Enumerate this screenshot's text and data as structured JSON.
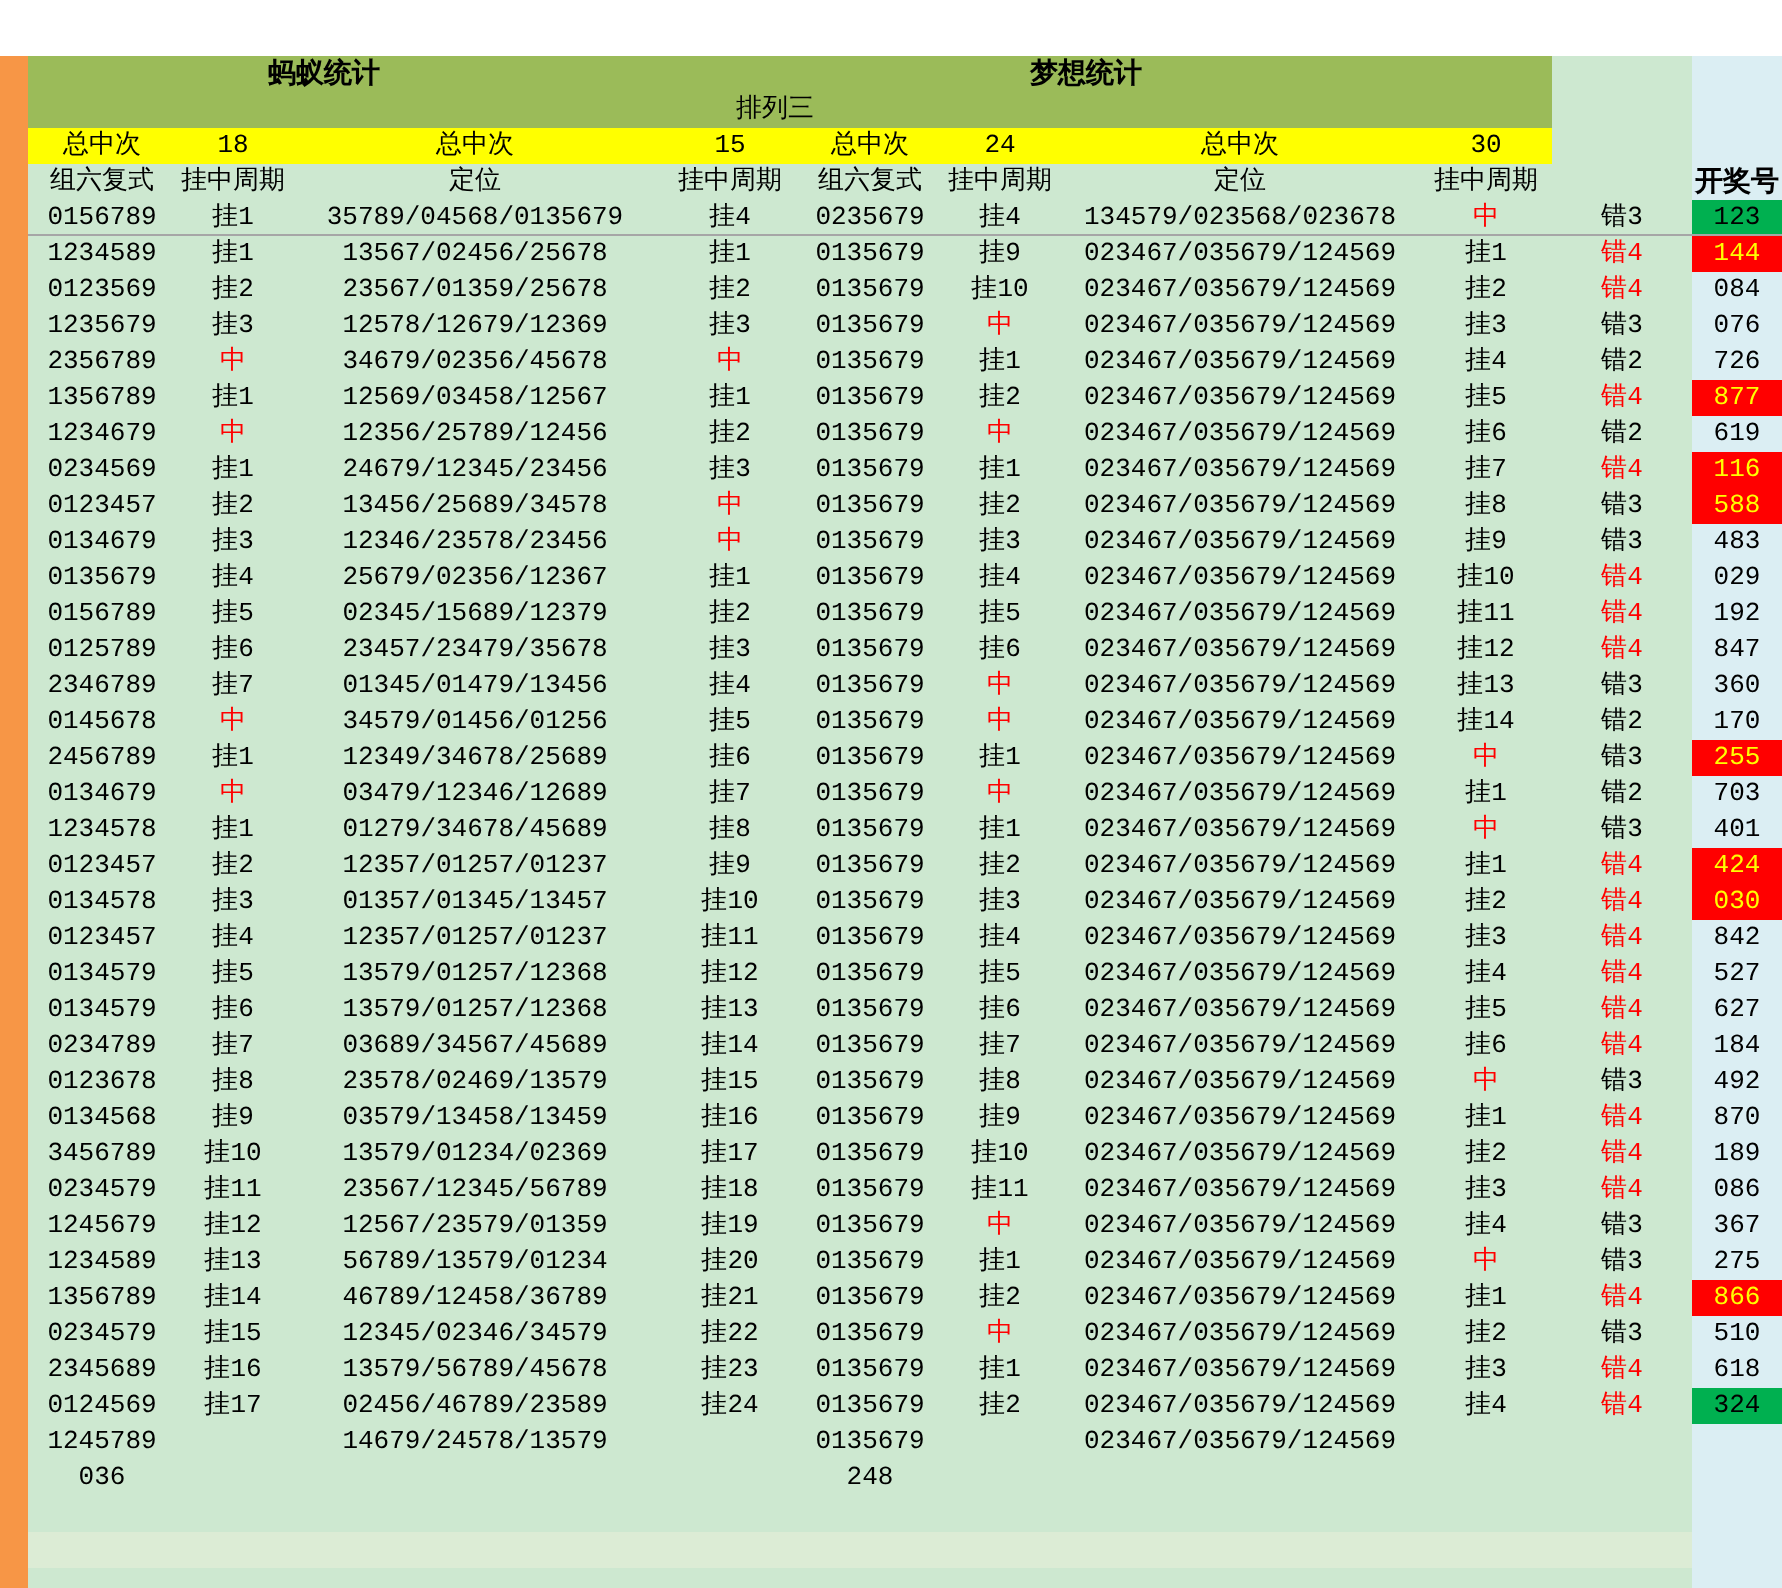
{
  "titles": [
    "蚂蚁统计",
    "梦想统计"
  ],
  "subtitle": "排列三",
  "totals": [
    "总中次",
    "18",
    "总中次",
    "15",
    "总中次",
    "24",
    "总中次",
    "30"
  ],
  "columns": [
    "组六复式",
    "挂中周期",
    "定位",
    "挂中周期",
    "组六复式",
    "挂中周期",
    "定位",
    "挂中周期"
  ],
  "draw_header": "开奖号",
  "rows": [
    {
      "cells": [
        "0156789",
        {
          "text": "挂1",
          "hit": false
        },
        "35789/04568/0135679",
        {
          "text": "挂4",
          "hit": false
        },
        "0235679",
        {
          "text": "挂4",
          "hit": false
        },
        "134579/023568/023678",
        {
          "text": "中",
          "hit": true
        }
      ],
      "miss": {
        "text": "错3",
        "alert": false
      },
      "draw": {
        "text": "123",
        "color": "#00b050"
      }
    },
    {
      "cells": [
        "1234589",
        {
          "text": "挂1",
          "hit": false
        },
        "13567/02456/25678",
        {
          "text": "挂1",
          "hit": false
        },
        "0135679",
        {
          "text": "挂9",
          "hit": false
        },
        "023467/035679/124569",
        {
          "text": "挂1",
          "hit": false
        }
      ],
      "miss": {
        "text": "错4",
        "alert": true
      },
      "draw": {
        "text": "144",
        "color": "#ff0000"
      }
    },
    {
      "cells": [
        "0123569",
        {
          "text": "挂2",
          "hit": false
        },
        "23567/01359/25678",
        {
          "text": "挂2",
          "hit": false
        },
        "0135679",
        {
          "text": "挂10",
          "hit": false
        },
        "023467/035679/124569",
        {
          "text": "挂2",
          "hit": false
        }
      ],
      "miss": {
        "text": "错4",
        "alert": true
      },
      "draw": {
        "text": "084"
      }
    },
    {
      "cells": [
        "1235679",
        {
          "text": "挂3",
          "hit": false
        },
        "12578/12679/12369",
        {
          "text": "挂3",
          "hit": false
        },
        "0135679",
        {
          "text": "中",
          "hit": true
        },
        "023467/035679/124569",
        {
          "text": "挂3",
          "hit": false
        }
      ],
      "miss": {
        "text": "错3",
        "alert": false
      },
      "draw": {
        "text": "076"
      }
    },
    {
      "cells": [
        "2356789",
        {
          "text": "中",
          "hit": true
        },
        "34679/02356/45678",
        {
          "text": "中",
          "hit": true
        },
        "0135679",
        {
          "text": "挂1",
          "hit": false
        },
        "023467/035679/124569",
        {
          "text": "挂4",
          "hit": false
        }
      ],
      "miss": {
        "text": "错2",
        "alert": false
      },
      "draw": {
        "text": "726"
      }
    },
    {
      "cells": [
        "1356789",
        {
          "text": "挂1",
          "hit": false
        },
        "12569/03458/12567",
        {
          "text": "挂1",
          "hit": false
        },
        "0135679",
        {
          "text": "挂2",
          "hit": false
        },
        "023467/035679/124569",
        {
          "text": "挂5",
          "hit": false
        }
      ],
      "miss": {
        "text": "错4",
        "alert": true
      },
      "draw": {
        "text": "877",
        "color": "#ff0000"
      }
    },
    {
      "cells": [
        "1234679",
        {
          "text": "中",
          "hit": true
        },
        "12356/25789/12456",
        {
          "text": "挂2",
          "hit": false
        },
        "0135679",
        {
          "text": "中",
          "hit": true
        },
        "023467/035679/124569",
        {
          "text": "挂6",
          "hit": false
        }
      ],
      "miss": {
        "text": "错2",
        "alert": false
      },
      "draw": {
        "text": "619"
      }
    },
    {
      "cells": [
        "0234569",
        {
          "text": "挂1",
          "hit": false
        },
        "24679/12345/23456",
        {
          "text": "挂3",
          "hit": false
        },
        "0135679",
        {
          "text": "挂1",
          "hit": false
        },
        "023467/035679/124569",
        {
          "text": "挂7",
          "hit": false
        }
      ],
      "miss": {
        "text": "错4",
        "alert": true
      },
      "draw": {
        "text": "116",
        "color": "#ff0000"
      }
    },
    {
      "cells": [
        "0123457",
        {
          "text": "挂2",
          "hit": false
        },
        "13456/25689/34578",
        {
          "text": "中",
          "hit": true
        },
        "0135679",
        {
          "text": "挂2",
          "hit": false
        },
        "023467/035679/124569",
        {
          "text": "挂8",
          "hit": false
        }
      ],
      "miss": {
        "text": "错3",
        "alert": false
      },
      "draw": {
        "text": "588",
        "color": "#ff0000"
      }
    },
    {
      "cells": [
        "0134679",
        {
          "text": "挂3",
          "hit": false
        },
        "12346/23578/23456",
        {
          "text": "中",
          "hit": true
        },
        "0135679",
        {
          "text": "挂3",
          "hit": false
        },
        "023467/035679/124569",
        {
          "text": "挂9",
          "hit": false
        }
      ],
      "miss": {
        "text": "错3",
        "alert": false
      },
      "draw": {
        "text": "483"
      }
    },
    {
      "cells": [
        "0135679",
        {
          "text": "挂4",
          "hit": false
        },
        "25679/02356/12367",
        {
          "text": "挂1",
          "hit": false
        },
        "0135679",
        {
          "text": "挂4",
          "hit": false
        },
        "023467/035679/124569",
        {
          "text": "挂10",
          "hit": false
        }
      ],
      "miss": {
        "text": "错4",
        "alert": true
      },
      "draw": {
        "text": "029"
      }
    },
    {
      "cells": [
        "0156789",
        {
          "text": "挂5",
          "hit": false
        },
        "02345/15689/12379",
        {
          "text": "挂2",
          "hit": false
        },
        "0135679",
        {
          "text": "挂5",
          "hit": false
        },
        "023467/035679/124569",
        {
          "text": "挂11",
          "hit": false
        }
      ],
      "miss": {
        "text": "错4",
        "alert": true
      },
      "draw": {
        "text": "192"
      }
    },
    {
      "cells": [
        "0125789",
        {
          "text": "挂6",
          "hit": false
        },
        "23457/23479/35678",
        {
          "text": "挂3",
          "hit": false
        },
        "0135679",
        {
          "text": "挂6",
          "hit": false
        },
        "023467/035679/124569",
        {
          "text": "挂12",
          "hit": false
        }
      ],
      "miss": {
        "text": "错4",
        "alert": true
      },
      "draw": {
        "text": "847"
      }
    },
    {
      "cells": [
        "2346789",
        {
          "text": "挂7",
          "hit": false
        },
        "01345/01479/13456",
        {
          "text": "挂4",
          "hit": false
        },
        "0135679",
        {
          "text": "中",
          "hit": true
        },
        "023467/035679/124569",
        {
          "text": "挂13",
          "hit": false
        }
      ],
      "miss": {
        "text": "错3",
        "alert": false
      },
      "draw": {
        "text": "360"
      }
    },
    {
      "cells": [
        "0145678",
        {
          "text": "中",
          "hit": true
        },
        "34579/01456/01256",
        {
          "text": "挂5",
          "hit": false
        },
        "0135679",
        {
          "text": "中",
          "hit": true
        },
        "023467/035679/124569",
        {
          "text": "挂14",
          "hit": false
        }
      ],
      "miss": {
        "text": "错2",
        "alert": false
      },
      "draw": {
        "text": "170"
      }
    },
    {
      "cells": [
        "2456789",
        {
          "text": "挂1",
          "hit": false
        },
        "12349/34678/25689",
        {
          "text": "挂6",
          "hit": false
        },
        "0135679",
        {
          "text": "挂1",
          "hit": false
        },
        "023467/035679/124569",
        {
          "text": "中",
          "hit": true
        }
      ],
      "miss": {
        "text": "错3",
        "alert": false
      },
      "draw": {
        "text": "255",
        "color": "#ff0000"
      }
    },
    {
      "cells": [
        "0134679",
        {
          "text": "中",
          "hit": true
        },
        "03479/12346/12689",
        {
          "text": "挂7",
          "hit": false
        },
        "0135679",
        {
          "text": "中",
          "hit": true
        },
        "023467/035679/124569",
        {
          "text": "挂1",
          "hit": false
        }
      ],
      "miss": {
        "text": "错2",
        "alert": false
      },
      "draw": {
        "text": "703"
      }
    },
    {
      "cells": [
        "1234578",
        {
          "text": "挂1",
          "hit": false
        },
        "01279/34678/45689",
        {
          "text": "挂8",
          "hit": false
        },
        "0135679",
        {
          "text": "挂1",
          "hit": false
        },
        "023467/035679/124569",
        {
          "text": "中",
          "hit": true
        }
      ],
      "miss": {
        "text": "错3",
        "alert": false
      },
      "draw": {
        "text": "401"
      }
    },
    {
      "cells": [
        "0123457",
        {
          "text": "挂2",
          "hit": false
        },
        "12357/01257/01237",
        {
          "text": "挂9",
          "hit": false
        },
        "0135679",
        {
          "text": "挂2",
          "hit": false
        },
        "023467/035679/124569",
        {
          "text": "挂1",
          "hit": false
        }
      ],
      "miss": {
        "text": "错4",
        "alert": true
      },
      "draw": {
        "text": "424",
        "color": "#ff0000"
      }
    },
    {
      "cells": [
        "0134578",
        {
          "text": "挂3",
          "hit": false
        },
        "01357/01345/13457",
        {
          "text": "挂10",
          "hit": false
        },
        "0135679",
        {
          "text": "挂3",
          "hit": false
        },
        "023467/035679/124569",
        {
          "text": "挂2",
          "hit": false
        }
      ],
      "miss": {
        "text": "错4",
        "alert": true
      },
      "draw": {
        "text": "030",
        "color": "#ff0000"
      }
    },
    {
      "cells": [
        "0123457",
        {
          "text": "挂4",
          "hit": false
        },
        "12357/01257/01237",
        {
          "text": "挂11",
          "hit": false
        },
        "0135679",
        {
          "text": "挂4",
          "hit": false
        },
        "023467/035679/124569",
        {
          "text": "挂3",
          "hit": false
        }
      ],
      "miss": {
        "text": "错4",
        "alert": true
      },
      "draw": {
        "text": "842"
      }
    },
    {
      "cells": [
        "0134579",
        {
          "text": "挂5",
          "hit": false
        },
        "13579/01257/12368",
        {
          "text": "挂12",
          "hit": false
        },
        "0135679",
        {
          "text": "挂5",
          "hit": false
        },
        "023467/035679/124569",
        {
          "text": "挂4",
          "hit": false
        }
      ],
      "miss": {
        "text": "错4",
        "alert": true
      },
      "draw": {
        "text": "527"
      }
    },
    {
      "cells": [
        "0134579",
        {
          "text": "挂6",
          "hit": false
        },
        "13579/01257/12368",
        {
          "text": "挂13",
          "hit": false
        },
        "0135679",
        {
          "text": "挂6",
          "hit": false
        },
        "023467/035679/124569",
        {
          "text": "挂5",
          "hit": false
        }
      ],
      "miss": {
        "text": "错4",
        "alert": true
      },
      "draw": {
        "text": "627"
      }
    },
    {
      "cells": [
        "0234789",
        {
          "text": "挂7",
          "hit": false
        },
        "03689/34567/45689",
        {
          "text": "挂14",
          "hit": false
        },
        "0135679",
        {
          "text": "挂7",
          "hit": false
        },
        "023467/035679/124569",
        {
          "text": "挂6",
          "hit": false
        }
      ],
      "miss": {
        "text": "错4",
        "alert": true
      },
      "draw": {
        "text": "184"
      }
    },
    {
      "cells": [
        "0123678",
        {
          "text": "挂8",
          "hit": false
        },
        "23578/02469/13579",
        {
          "text": "挂15",
          "hit": false
        },
        "0135679",
        {
          "text": "挂8",
          "hit": false
        },
        "023467/035679/124569",
        {
          "text": "中",
          "hit": true
        }
      ],
      "miss": {
        "text": "错3",
        "alert": false
      },
      "draw": {
        "text": "492"
      }
    },
    {
      "cells": [
        "0134568",
        {
          "text": "挂9",
          "hit": false
        },
        "03579/13458/13459",
        {
          "text": "挂16",
          "hit": false
        },
        "0135679",
        {
          "text": "挂9",
          "hit": false
        },
        "023467/035679/124569",
        {
          "text": "挂1",
          "hit": false
        }
      ],
      "miss": {
        "text": "错4",
        "alert": true
      },
      "draw": {
        "text": "870"
      }
    },
    {
      "cells": [
        "3456789",
        {
          "text": "挂10",
          "hit": false
        },
        "13579/01234/02369",
        {
          "text": "挂17",
          "hit": false
        },
        "0135679",
        {
          "text": "挂10",
          "hit": false
        },
        "023467/035679/124569",
        {
          "text": "挂2",
          "hit": false
        }
      ],
      "miss": {
        "text": "错4",
        "alert": true
      },
      "draw": {
        "text": "189"
      }
    },
    {
      "cells": [
        "0234579",
        {
          "text": "挂11",
          "hit": false
        },
        "23567/12345/56789",
        {
          "text": "挂18",
          "hit": false
        },
        "0135679",
        {
          "text": "挂11",
          "hit": false
        },
        "023467/035679/124569",
        {
          "text": "挂3",
          "hit": false
        }
      ],
      "miss": {
        "text": "错4",
        "alert": true
      },
      "draw": {
        "text": "086"
      }
    },
    {
      "cells": [
        "1245679",
        {
          "text": "挂12",
          "hit": false
        },
        "12567/23579/01359",
        {
          "text": "挂19",
          "hit": false
        },
        "0135679",
        {
          "text": "中",
          "hit": true
        },
        "023467/035679/124569",
        {
          "text": "挂4",
          "hit": false
        }
      ],
      "miss": {
        "text": "错3",
        "alert": false
      },
      "draw": {
        "text": "367"
      }
    },
    {
      "cells": [
        "1234589",
        {
          "text": "挂13",
          "hit": false
        },
        "56789/13579/01234",
        {
          "text": "挂20",
          "hit": false
        },
        "0135679",
        {
          "text": "挂1",
          "hit": false
        },
        "023467/035679/124569",
        {
          "text": "中",
          "hit": true
        }
      ],
      "miss": {
        "text": "错3",
        "alert": false
      },
      "draw": {
        "text": "275"
      }
    },
    {
      "cells": [
        "1356789",
        {
          "text": "挂14",
          "hit": false
        },
        "46789/12458/36789",
        {
          "text": "挂21",
          "hit": false
        },
        "0135679",
        {
          "text": "挂2",
          "hit": false
        },
        "023467/035679/124569",
        {
          "text": "挂1",
          "hit": false
        }
      ],
      "miss": {
        "text": "错4",
        "alert": true
      },
      "draw": {
        "text": "866",
        "color": "#ff0000"
      }
    },
    {
      "cells": [
        "0234579",
        {
          "text": "挂15",
          "hit": false
        },
        "12345/02346/34579",
        {
          "text": "挂22",
          "hit": false
        },
        "0135679",
        {
          "text": "中",
          "hit": true
        },
        "023467/035679/124569",
        {
          "text": "挂2",
          "hit": false
        }
      ],
      "miss": {
        "text": "错3",
        "alert": false
      },
      "draw": {
        "text": "510"
      }
    },
    {
      "cells": [
        "2345689",
        {
          "text": "挂16",
          "hit": false
        },
        "13579/56789/45678",
        {
          "text": "挂23",
          "hit": false
        },
        "0135679",
        {
          "text": "挂1",
          "hit": false
        },
        "023467/035679/124569",
        {
          "text": "挂3",
          "hit": false
        }
      ],
      "miss": {
        "text": "错4",
        "alert": true
      },
      "draw": {
        "text": "618"
      }
    },
    {
      "cells": [
        "0124569",
        {
          "text": "挂17",
          "hit": false
        },
        "02456/46789/23589",
        {
          "text": "挂24",
          "hit": false
        },
        "0135679",
        {
          "text": "挂2",
          "hit": false
        },
        "023467/035679/124569",
        {
          "text": "挂4",
          "hit": false
        }
      ],
      "miss": {
        "text": "错4",
        "alert": true
      },
      "draw": {
        "text": "324",
        "color": "#00b050"
      }
    },
    {
      "cells": [
        "1245789",
        null,
        "14679/24578/13579",
        null,
        "0135679",
        null,
        "023467/035679/124569",
        null
      ]
    }
  ],
  "footer": [
    "036",
    "248"
  ]
}
